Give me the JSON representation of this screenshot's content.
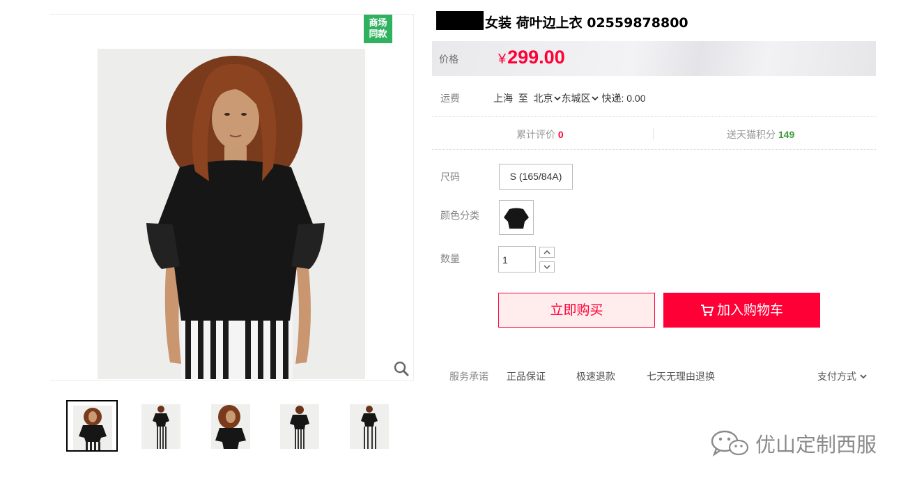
{
  "product": {
    "title": "女装 荷叶边上衣 02559878800",
    "badge_line1": "商场",
    "badge_line2": "同款"
  },
  "price": {
    "label": "价格",
    "currency": "¥",
    "value": "299.00"
  },
  "shipping": {
    "label": "运费",
    "from": "上海",
    "to_word": "至",
    "city": "北京",
    "district": "东城区",
    "express": "快递: 0.00"
  },
  "stats": {
    "reviews_label": "累计评价",
    "reviews_count": "0",
    "points_label": "送天猫积分",
    "points_value": "149"
  },
  "options": {
    "size_label": "尺码",
    "size_value": "S (165/84A)",
    "color_label": "颜色分类",
    "quantity_label": "数量",
    "quantity_value": "1"
  },
  "actions": {
    "buy_now": "立即购买",
    "add_to_cart": "加入购物车"
  },
  "services": {
    "label": "服务承诺",
    "items": [
      "正品保证",
      "极速退款",
      "七天无理由退换"
    ],
    "payment": "支付方式"
  },
  "watermark": {
    "text": "优山定制西服"
  },
  "colors": {
    "accent": "#ff0036",
    "badge_green": "#2fb15f",
    "points_green": "#3c9b3c"
  }
}
